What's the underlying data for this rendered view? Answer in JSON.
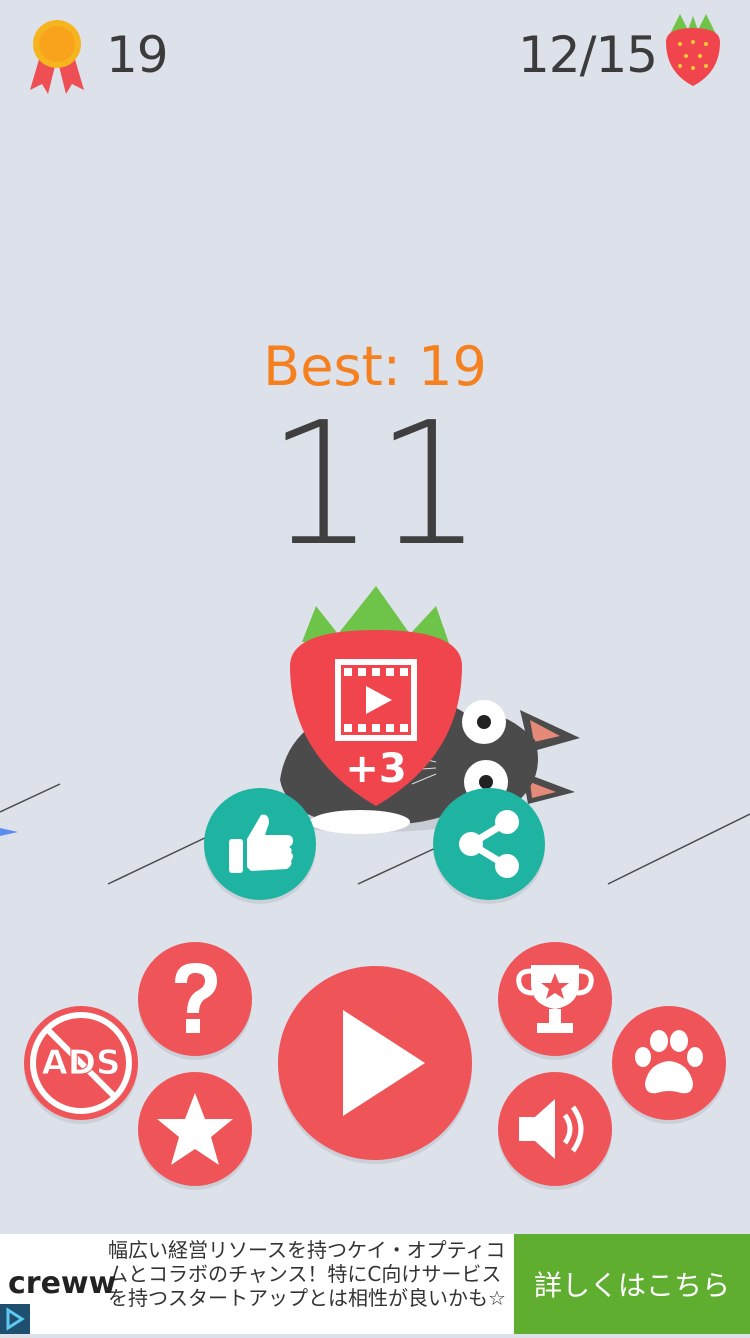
{
  "hud": {
    "medal_count": "19",
    "strawberry_progress": "12/15"
  },
  "game": {
    "best_label": "Best: 19",
    "score": "11",
    "video_bonus": "+3"
  },
  "buttons": {
    "no_ads_label": "ADS"
  },
  "ad": {
    "brand": "creww",
    "text": "幅広い経営リソースを持つケイ・オプティコムとコラボのチャンス！特にC向けサービスを持つスタートアップとは相性が良いかも☆",
    "cta": "詳しくはこちら"
  },
  "colors": {
    "background": "#dde1ea",
    "button_red": "#ee5458",
    "button_teal": "#1fb4a2",
    "best_orange": "#f5801f",
    "ad_green": "#5fae2f"
  }
}
